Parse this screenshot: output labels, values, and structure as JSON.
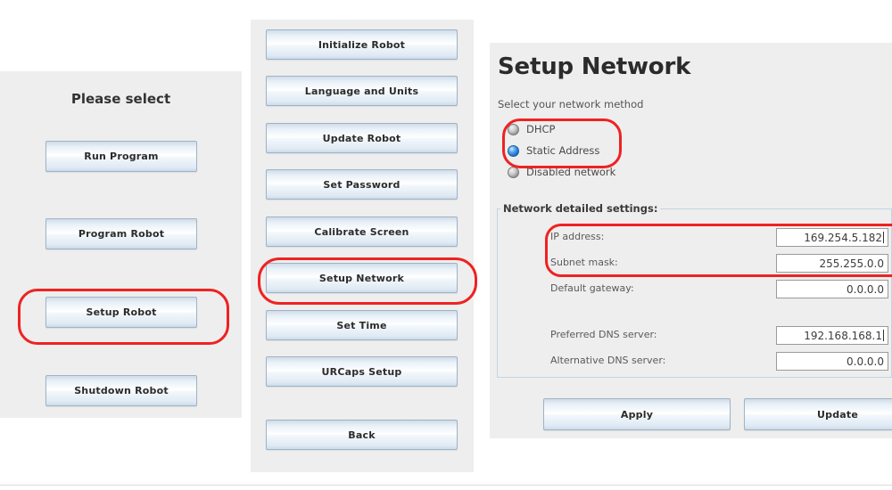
{
  "left_panel": {
    "heading": "Please select",
    "buttons": [
      {
        "label": "Run Program"
      },
      {
        "label": "Program Robot"
      },
      {
        "label": "Setup Robot"
      },
      {
        "label": "Shutdown Robot"
      }
    ]
  },
  "mid_panel": {
    "buttons": [
      {
        "label": "Initialize Robot"
      },
      {
        "label": "Language and Units"
      },
      {
        "label": "Update Robot"
      },
      {
        "label": "Set Password"
      },
      {
        "label": "Calibrate Screen"
      },
      {
        "label": "Setup Network"
      },
      {
        "label": "Set Time"
      },
      {
        "label": "URCaps Setup"
      },
      {
        "label": "Back"
      }
    ]
  },
  "right_panel": {
    "title": "Setup Network",
    "method_prompt": "Select your network method",
    "methods": [
      {
        "label": "DHCP",
        "selected": false
      },
      {
        "label": "Static Address",
        "selected": true
      },
      {
        "label": "Disabled network",
        "selected": false
      }
    ],
    "group_title": "Network detailed settings:",
    "fields": [
      {
        "label": "IP address:",
        "value": "169.254.5.182",
        "caret": true
      },
      {
        "label": "Subnet mask:",
        "value": "255.255.0.0",
        "caret": false
      },
      {
        "label": "Default gateway:",
        "value": "0.0.0.0",
        "caret": false
      },
      {
        "label": "Preferred DNS server:",
        "value": "192.168.168.1",
        "caret": true
      },
      {
        "label": "Alternative DNS server:",
        "value": "0.0.0.0",
        "caret": false
      }
    ],
    "actions": [
      {
        "label": "Apply"
      },
      {
        "label": "Update"
      }
    ]
  },
  "annotations": {
    "color": "#ef2222",
    "highlights": [
      "setup-robot-button",
      "setup-network-button",
      "network-method-dhcp-static",
      "ip-and-subnet-fields"
    ]
  }
}
